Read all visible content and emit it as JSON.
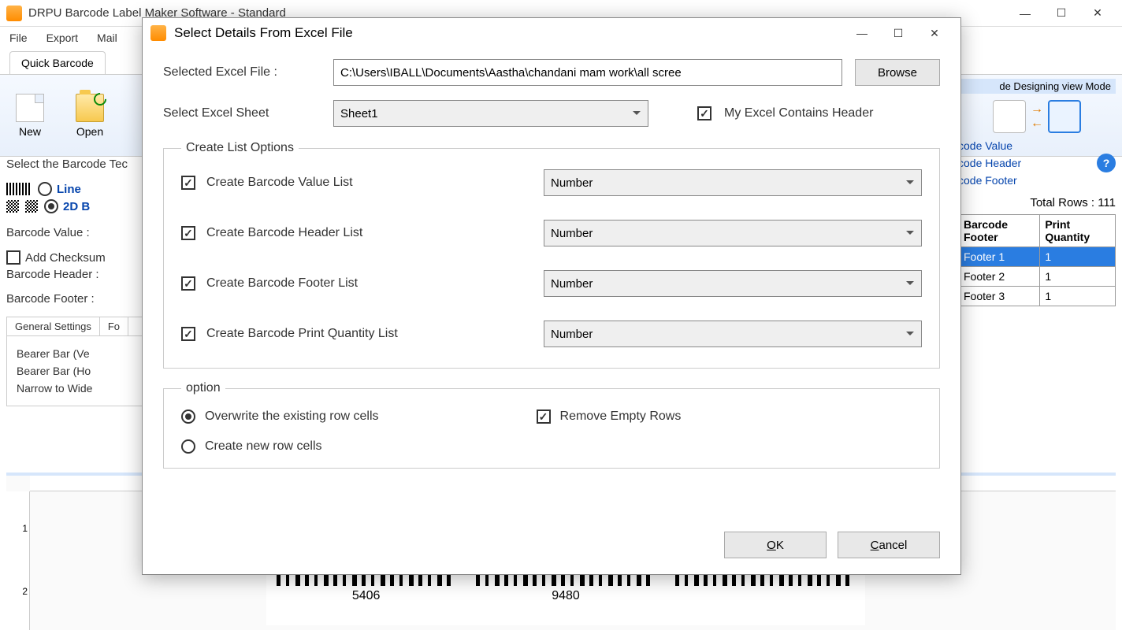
{
  "main": {
    "title": "DRPU Barcode Label Maker Software - Standard",
    "menu": [
      "File",
      "Export",
      "Mail"
    ],
    "tab": "Quick Barcode",
    "ribbon": {
      "new": "New",
      "open": "Open"
    },
    "design_mode_label": "de Designing view Mode"
  },
  "left": {
    "selectTech": "Select the Barcode Tec",
    "linear": "Line",
    "twod": "2D B",
    "barcodeValue": "Barcode Value :",
    "addChecksum": "Add Checksum",
    "barcodeHeader": "Barcode Header :",
    "barcodeFooter": "Barcode Footer :",
    "generalSettings": "General Settings",
    "fontTab": "Fo",
    "bearerV": "Bearer Bar (Ve",
    "bearerH": "Bearer Bar (Ho",
    "narrow": "Narrow to Wide"
  },
  "right": {
    "links": [
      "code Value",
      "code Header",
      "code Footer"
    ],
    "totalRows": "Total Rows : 111",
    "table": {
      "headers": [
        "Barcode Footer",
        "Print Quantity"
      ],
      "rows": [
        {
          "footer": "Footer 1",
          "qty": "1",
          "selected": true
        },
        {
          "footer": "Footer 2",
          "qty": "1",
          "selected": false
        },
        {
          "footer": "Footer 3",
          "qty": "1",
          "selected": false
        }
      ]
    }
  },
  "barcode": {
    "lbl1": "5406",
    "lbl2": "9480"
  },
  "dialog": {
    "title": "Select Details From Excel File",
    "selectedFileLabel": "Selected Excel File :",
    "selectedFile": "C:\\Users\\IBALL\\Documents\\Aastha\\chandani mam work\\all scree",
    "browse": "Browse",
    "selectSheetLabel": "Select Excel Sheet",
    "sheet": "Sheet1",
    "hasHeader": "My Excel Contains Header",
    "createListLegend": "Create List Options",
    "lists": [
      {
        "label": "Create Barcode Value List",
        "value": "Number"
      },
      {
        "label": "Create Barcode Header List",
        "value": "Number"
      },
      {
        "label": "Create Barcode Footer List",
        "value": "Number"
      },
      {
        "label": "Create Barcode Print Quantity List",
        "value": "Number"
      }
    ],
    "optionLegend": "option",
    "overwrite": "Overwrite the existing row cells",
    "createNew": "Create new row cells",
    "removeEmpty": "Remove Empty Rows",
    "ok": "OK",
    "cancel": "Cancel"
  }
}
